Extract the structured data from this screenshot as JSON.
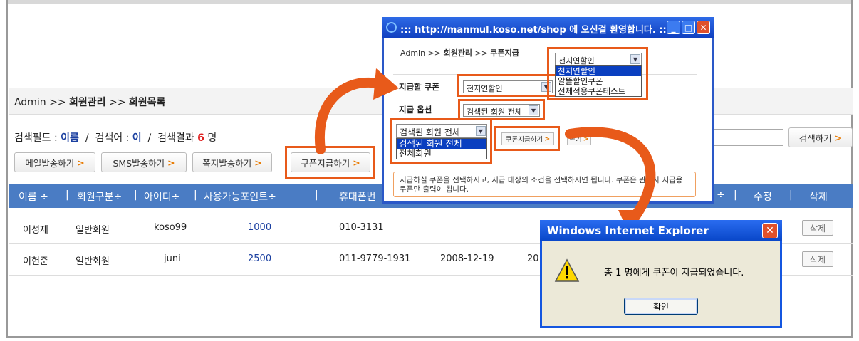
{
  "breadcrumb": {
    "admin": "Admin",
    "sep": ">>",
    "section": "회원관리",
    "page": "회원목록"
  },
  "search_info": {
    "field_label": "검색필드 :",
    "field_value": "이름",
    "sep1": "/",
    "term_label": "검색어 :",
    "term_value": "이",
    "sep2": "/",
    "result_label": "검색결과",
    "result_count": "6",
    "result_unit": "명"
  },
  "search_button": "검색하기",
  "actions": {
    "mail": "메일발송하기",
    "sms": "SMS발송하기",
    "note": "쪽지발송하기",
    "coupon": "쿠폰지급하기"
  },
  "table": {
    "headers": [
      "이름",
      "회원구분",
      "아이디",
      "사용가능포인트",
      "휴대폰번",
      "",
      "",
      "수정",
      "삭제"
    ],
    "sort_mark": "÷",
    "rows": [
      {
        "name": "이성재",
        "type": "일반회원",
        "id": "koso99",
        "points": "1000",
        "phone": "010-3131",
        "date": "",
        "delete": "삭제"
      },
      {
        "name": "이헌준",
        "type": "일반회원",
        "id": "juni",
        "points": "2500",
        "phone": "011-9779-1931",
        "date": "2008-12-19",
        "extra": "20",
        "delete": "삭제"
      }
    ]
  },
  "popup": {
    "title": "::: http://manmul.koso.net/shop 에 오신걸 환영합니다. :::...",
    "breadcrumb": {
      "admin": "Admin",
      "sep": ">>",
      "section": "회원관리",
      "page": "쿠폰지급"
    },
    "coupon_label": "지급할 쿠폰",
    "coupon_value": "천지연할인",
    "option_label": "지급 옵션",
    "option_value": "검색된 회원 전체",
    "coupon_dropdown": {
      "selected": "천지연할인",
      "options": [
        "천지연할인",
        "알뜰할인쿠폰",
        "전체적용쿠폰테스트"
      ]
    },
    "option_dropdown": {
      "selected": "검색된 회원 전체",
      "options": [
        "검색된 회원 전체",
        "전체회원"
      ]
    },
    "give_button": "쿠폰지급하기",
    "close_button": "닫기",
    "note": "지급하실 쿠폰을 선택하시고, 지급 대상의 조건을 선택하시면 됩니다. 쿠폰은 관리자 지급용 쿠폰만 출력이 됩니다."
  },
  "dialog": {
    "title": "Windows Internet Explorer",
    "message": "총 1 명에게 쿠폰이 지급되었습니다.",
    "ok": "확인"
  },
  "colors": {
    "accent_orange": "#e85a1a",
    "header_blue": "#4a7cc4",
    "xp_blue": "#1456e0",
    "count_red": "#e02020"
  }
}
